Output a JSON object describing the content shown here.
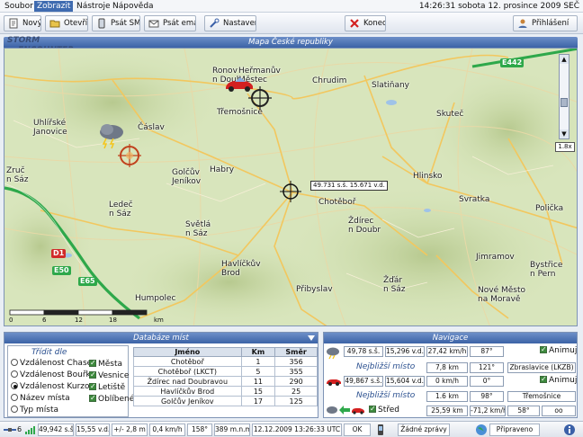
{
  "menu": [
    "Soubor",
    "Zobrazit",
    "Nástroje",
    "Nápověda"
  ],
  "clock": "14:26:31 sobota 12. prosince 2009 SEČ",
  "toolbar": {
    "new": "Nový",
    "open": "Otevřít",
    "sms": "Psát SMS",
    "email": "Psát email",
    "settings": "Nastavení",
    "exit": "Konec",
    "login": "Přihlášení"
  },
  "logo_text": "STORM ENCOUNTER",
  "map": {
    "title": "Mapa České republiky",
    "zoom": "1.8x",
    "cursor_coords": "49.731 s.š. 15.671 v.d.",
    "scale_ticks": [
      "0",
      "6",
      "12",
      "18"
    ],
    "scale_unit": "km",
    "roads": [
      "E442",
      "D1",
      "E50",
      "E65"
    ],
    "towns": [
      "Chrudim",
      "Slatiňany",
      "Heřmanův\nMěstec",
      "Ronov\nn Doub",
      "Čáslav",
      "Uhlířské\nJanovice",
      "Třemošnice",
      "Golčův\nJeníkov",
      "Skuteč",
      "Habry",
      "Chotěboř",
      "Hlinsko",
      "Zruč\nn Sáz",
      "Ledeč\nn Sáz",
      "Ždírec\nn Doubr",
      "Svratka",
      "Polička",
      "Světlá\nn Sáz",
      "Havlíčkův\nBrod",
      "Jimramov",
      "Bystřice\nn Pern",
      "Humpolec",
      "Přibyslav",
      "Žďár\nn Sáz",
      "Nové Město\nna Moravě"
    ]
  },
  "places": {
    "title": "Databáze míst",
    "filter_title": "Třídit dle",
    "sort_options": [
      "Vzdálenost Chaser",
      "Vzdálenost Bouřka",
      "Vzdálenost Kurzor",
      "Název místa",
      "Typ místa"
    ],
    "sort_selected": 2,
    "filters": [
      "Města",
      "Vesnice",
      "Letiště",
      "Oblíbené"
    ],
    "columns": [
      "Jméno",
      "Km",
      "Směr"
    ],
    "rows": [
      [
        "Chotěboř",
        "1",
        "356"
      ],
      [
        "Chotěboř (LKCT)",
        "5",
        "355"
      ],
      [
        "Ždírec nad Doubravou",
        "11",
        "290"
      ],
      [
        "Havlíčkův Brod",
        "15",
        "25"
      ],
      [
        "Golčův Jeníkov",
        "17",
        "125"
      ]
    ]
  },
  "navigation": {
    "title": "Navigace",
    "storm": {
      "lat": "49,78 s.š.",
      "lon": "15,296 v.d.",
      "speed": "27,42 km/h",
      "dir": "87°",
      "animate": "Animuj",
      "nearest_label": "Nejbližší místo",
      "nearest_dist": "7,8 km",
      "nearest_dir": "121°",
      "nearest_name": "Zbraslavice (LKZB)"
    },
    "chaser": {
      "lat": "49,867 s.š.",
      "lon": "15,604 v.d.",
      "speed": "0 km/h",
      "dir": "0°",
      "animate": "Animuj",
      "nearest_label": "Nejbližší místo",
      "nearest_dist": "1.6 km",
      "nearest_dir": "98°",
      "nearest_name": "Třemošnice"
    },
    "center": {
      "label": "Střed",
      "a": "25,59 km",
      "b": "-71,2 km/h",
      "c": "58°",
      "d": "oo"
    }
  },
  "status": {
    "signal": "6",
    "lat": "49,942 s.š.",
    "lon": "15,55 v.d.",
    "alt": "+/- 2,8 m",
    "speed": "0,4 km/h",
    "heading": "158°",
    "elev": "389 m.n.m",
    "datetime": "12.12.2009 13:26:33 UTC",
    "ok": "OK",
    "messages": "Žádné zprávy",
    "ready": "Připraveno"
  },
  "colors": {
    "header": "#3c63a6",
    "accent": "#2a4f8f"
  }
}
